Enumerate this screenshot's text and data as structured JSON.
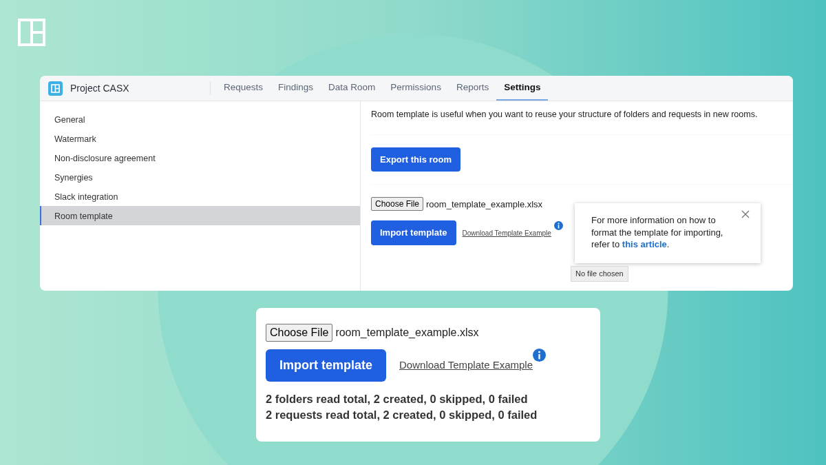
{
  "app": {
    "project": "Project CASX",
    "tabs": [
      {
        "label": "Requests",
        "selected": false
      },
      {
        "label": "Findings",
        "selected": false
      },
      {
        "label": "Data Room",
        "selected": false
      },
      {
        "label": "Permissions",
        "selected": false
      },
      {
        "label": "Reports",
        "selected": false
      },
      {
        "label": "Settings",
        "selected": true
      }
    ]
  },
  "sidebar": {
    "items": [
      {
        "label": "General",
        "selected": false
      },
      {
        "label": "Watermark",
        "selected": false
      },
      {
        "label": "Non-disclosure agreement",
        "selected": false
      },
      {
        "label": "Synergies",
        "selected": false
      },
      {
        "label": "Slack integration",
        "selected": false
      },
      {
        "label": "Room template",
        "selected": true
      }
    ]
  },
  "content": {
    "description": "Room template is useful when you want to reuse your structure of folders  and requests in new rooms.",
    "export_button": "Export this room",
    "file_input": {
      "button": "Choose File",
      "file_name": "room_template_example.xlsx"
    },
    "import_button": "Import template",
    "download_link": "Download Template Example",
    "popover": {
      "text_before": "For more information on how to format the template for importing, refer to ",
      "link": "this article",
      "text_after": "."
    },
    "tooltip": "No file chosen"
  },
  "zoom_panel": {
    "file_input": {
      "button": "Choose File",
      "file_name": "room_template_example.xlsx"
    },
    "import_button": "Import template",
    "download_link": "Download Template Example",
    "results": [
      "2 folders read total, 2 created, 0 skipped, 0 failed",
      "2 requests read total, 2 created, 0 skipped, 0 failed"
    ]
  }
}
